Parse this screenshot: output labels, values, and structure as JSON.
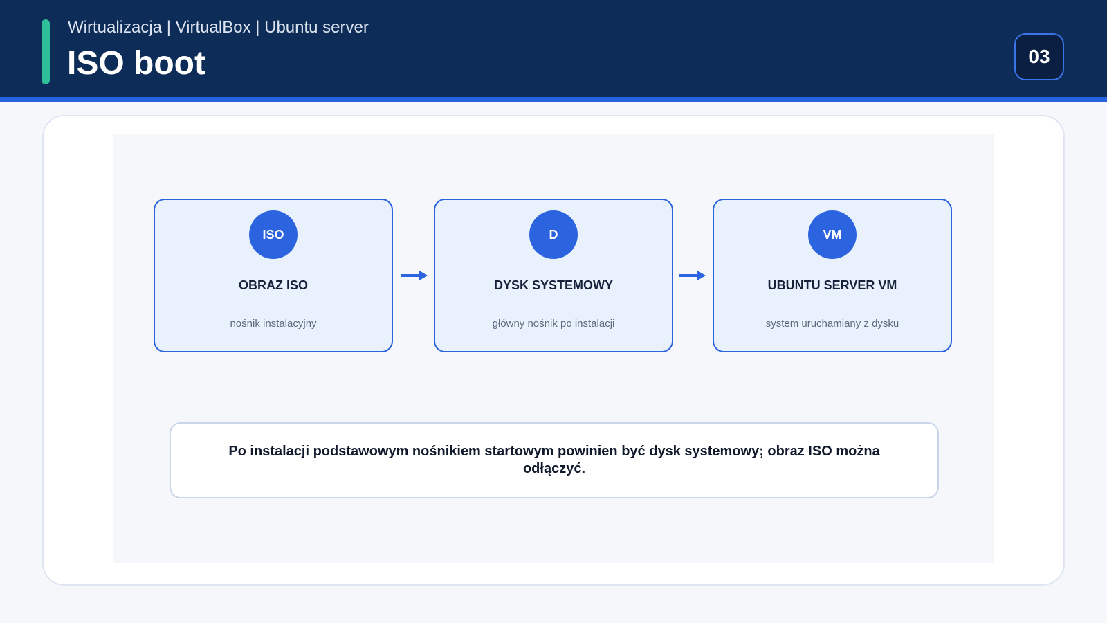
{
  "header": {
    "subtitle": "Wirtualizacja | VirtualBox | Ubuntu server",
    "title": "ISO boot",
    "page_number": "03"
  },
  "colors": {
    "header_bg": "#0d2c57",
    "accent_green": "#2ebf98",
    "accent_blue": "#2765e0",
    "node_fill": "#e9f1fd",
    "node_border": "#2b64de"
  },
  "flow": {
    "nodes": [
      {
        "badge": "ISO",
        "title": "OBRAZ ISO",
        "desc": "nośnik instalacyjny"
      },
      {
        "badge": "D",
        "title": "DYSK SYSTEMOWY",
        "desc": "główny nośnik po instalacji"
      },
      {
        "badge": "VM",
        "title": "UBUNTU SERVER VM",
        "desc": "system uruchamiany z dysku"
      }
    ],
    "arrow_icon": "arrow-right-icon"
  },
  "note": {
    "text": "Po instalacji podstawowym nośnikiem startowym powinien być dysk systemowy; obraz ISO można odłączyć."
  }
}
